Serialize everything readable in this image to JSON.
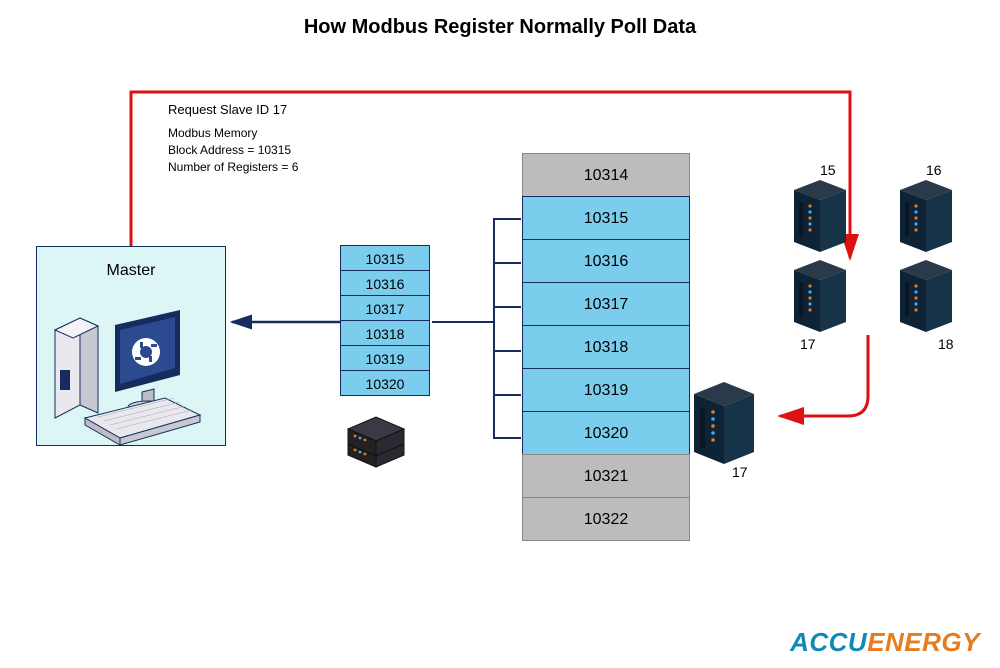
{
  "title": "How Modbus Register Normally Poll Data",
  "request_label": "Request Slave ID 17",
  "memory": {
    "line1": "Modbus Memory",
    "line2": "Block Address = 10315",
    "line3": "Number of Registers = 6"
  },
  "master_label": "Master",
  "small_registers": [
    "10315",
    "10316",
    "10317",
    "10318",
    "10319",
    "10320"
  ],
  "big_registers": [
    {
      "addr": "10314",
      "class": "gray"
    },
    {
      "addr": "10315",
      "class": "blue"
    },
    {
      "addr": "10316",
      "class": "blue"
    },
    {
      "addr": "10317",
      "class": "blue"
    },
    {
      "addr": "10318",
      "class": "blue"
    },
    {
      "addr": "10319",
      "class": "blue"
    },
    {
      "addr": "10320",
      "class": "blue"
    },
    {
      "addr": "10321",
      "class": "gray"
    },
    {
      "addr": "10322",
      "class": "gray"
    }
  ],
  "slaves": {
    "s15": "15",
    "s16": "16",
    "s17": "17",
    "s18": "18",
    "s17b": "17"
  },
  "brand": {
    "part1": "ACCU",
    "part2": "ENERGY"
  }
}
